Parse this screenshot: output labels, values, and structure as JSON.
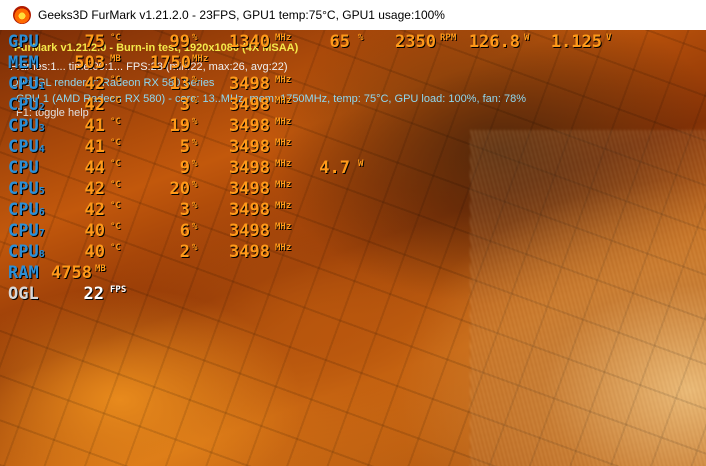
{
  "window": {
    "title": "Geeks3D FurMark v1.21.2.0 - 23FPS, GPU1 temp:75°C, GPU1 usage:100%"
  },
  "furmark": {
    "line1": "FurMark v1.21.2.0 - Burn-in test, 1920x1080 (4X MSAA)",
    "line2": "Frames:1...  time:00:1...  FPS:23 (min:22, max:26, avg:22)",
    "line3": "OpenGL renderer: Radeon RX 580 Series",
    "line4": "GPU 1 (AMD Radeon RX 580) - core: 13..MHz, mem: 1750MHz, temp: 75°C, GPU load: 100%, fan: 78%",
    "line5": "F1: toggle help"
  },
  "osd": {
    "gpu": {
      "label": "GPU",
      "temp": "75",
      "temp_unit": "°C",
      "usage": "99",
      "usage_unit": "%",
      "clock": "1340",
      "clock_unit": "MHz",
      "fan": "65",
      "fan_unit": "%",
      "rpm": "2350",
      "rpm_unit": "RPM",
      "power": "126.8",
      "power_unit": "W",
      "voltage": "1.125",
      "voltage_unit": "V"
    },
    "mem": {
      "label": "MEM",
      "used": "503",
      "used_unit": "MB",
      "clock": "1750",
      "clock_unit": "MHz"
    },
    "cpus": [
      {
        "label": "CPU",
        "sub": "1",
        "temp": "42",
        "usage": "13",
        "clock": "3498"
      },
      {
        "label": "CPU",
        "sub": "2",
        "temp": "42",
        "usage": "3",
        "clock": "3498"
      },
      {
        "label": "CPU",
        "sub": "3",
        "temp": "41",
        "usage": "19",
        "clock": "3498"
      },
      {
        "label": "CPU",
        "sub": "4",
        "temp": "41",
        "usage": "5",
        "clock": "3498"
      },
      {
        "label": "CPU",
        "sub": "",
        "temp": "44",
        "usage": "9",
        "clock": "3498",
        "power": "4.7",
        "power_unit": "W"
      },
      {
        "label": "CPU",
        "sub": "5",
        "temp": "42",
        "usage": "20",
        "clock": "3498"
      },
      {
        "label": "CPU",
        "sub": "6",
        "temp": "42",
        "usage": "3",
        "clock": "3498"
      },
      {
        "label": "CPU",
        "sub": "7",
        "temp": "40",
        "usage": "6",
        "clock": "3498"
      },
      {
        "label": "CPU",
        "sub": "8",
        "temp": "40",
        "usage": "2",
        "clock": "3498"
      }
    ],
    "cpu_units": {
      "temp": "°C",
      "usage": "%",
      "clock": "MHz"
    },
    "ram": {
      "label": "RAM",
      "used": "4758",
      "used_unit": "MB"
    },
    "ogl": {
      "label": "OGL",
      "fps": "22",
      "fps_unit": "FPS"
    }
  }
}
